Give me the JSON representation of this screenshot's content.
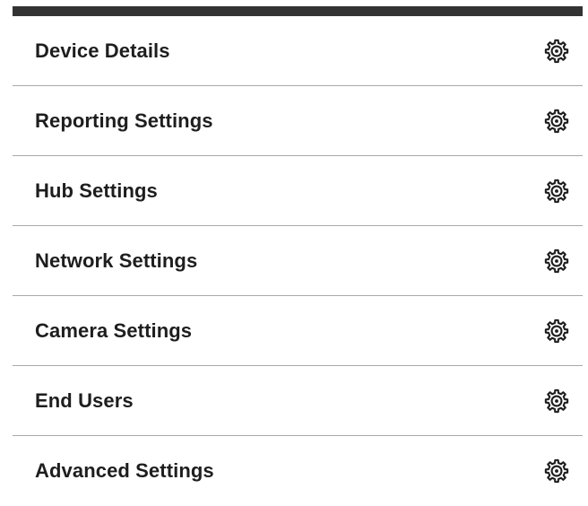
{
  "settings_menu": {
    "items": [
      {
        "label": "Device Details",
        "icon": "gear-icon"
      },
      {
        "label": "Reporting Settings",
        "icon": "gear-icon"
      },
      {
        "label": "Hub Settings",
        "icon": "gear-icon"
      },
      {
        "label": "Network Settings",
        "icon": "gear-icon"
      },
      {
        "label": "Camera Settings",
        "icon": "gear-icon"
      },
      {
        "label": "End Users",
        "icon": "gear-icon"
      },
      {
        "label": "Advanced Settings",
        "icon": "gear-icon"
      }
    ]
  },
  "colors": {
    "top_bar": "#333333",
    "text": "#1e1e1e",
    "divider": "#a9a9a9",
    "background": "#ffffff"
  }
}
